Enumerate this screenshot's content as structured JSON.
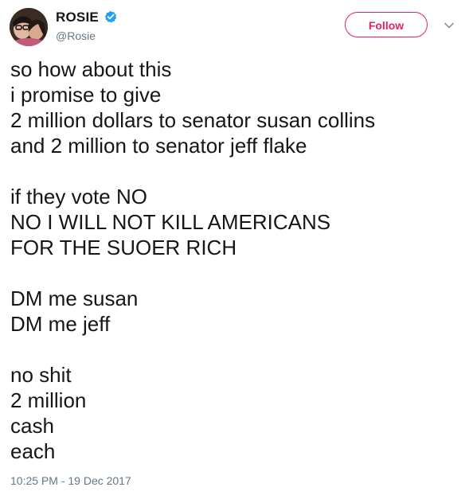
{
  "user": {
    "display_name": "ROSIE",
    "handle": "@Rosie",
    "verified": true,
    "verified_icon": "verified-badge-icon"
  },
  "follow_button": {
    "label": "Follow",
    "color": "#e0245e"
  },
  "menu": {
    "icon": "chevron-down-icon"
  },
  "tweet": {
    "lines": [
      "so how about this",
      "i promise to give",
      "2 million dollars to senator susan collins",
      "and 2 million to senator jeff flake",
      "",
      "if they vote NO",
      "NO I WILL NOT KILL AMERICANS",
      "FOR THE SUOER RICH",
      "",
      "DM me susan",
      "DM me jeff",
      "",
      "no shit",
      "2 million",
      "cash",
      "each"
    ],
    "timestamp": "10:25 PM - 19 Dec 2017"
  },
  "colors": {
    "text": "#14171a",
    "secondary_text": "#657786",
    "verified_blue": "#1da1f2"
  }
}
